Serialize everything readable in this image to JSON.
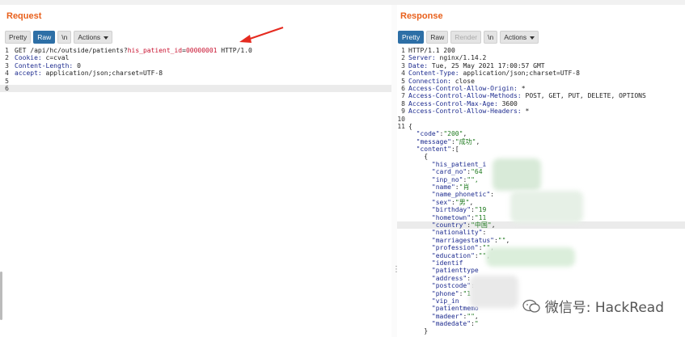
{
  "request": {
    "title": "Request",
    "toolbar": {
      "pretty": "Pretty",
      "raw": "Raw",
      "newline": "\\n",
      "actions": "Actions"
    },
    "lines": [
      {
        "n": "1",
        "parts": [
          {
            "t": "GET /api/hc/outside/patients?",
            "c": "plain"
          },
          {
            "t": "his_patient_id",
            "c": "red"
          },
          {
            "t": "=",
            "c": "plain"
          },
          {
            "t": "00000001",
            "c": "red"
          },
          {
            "t": " HTTP/1.0",
            "c": "plain"
          }
        ]
      },
      {
        "n": "2",
        "parts": [
          {
            "t": "Cookie: ",
            "c": "hk"
          },
          {
            "t": "c=cval",
            "c": "hv"
          }
        ]
      },
      {
        "n": "3",
        "parts": [
          {
            "t": "Content-Length: ",
            "c": "hk"
          },
          {
            "t": "0",
            "c": "hv"
          }
        ]
      },
      {
        "n": "4",
        "parts": [
          {
            "t": "accept: ",
            "c": "hk"
          },
          {
            "t": "application/json;charset=UTF-8",
            "c": "hv"
          }
        ]
      },
      {
        "n": "5",
        "parts": []
      },
      {
        "n": "6",
        "parts": [],
        "highlight": true
      }
    ]
  },
  "response": {
    "title": "Response",
    "toolbar": {
      "pretty": "Pretty",
      "raw": "Raw",
      "render": "Render",
      "newline": "\\n",
      "actions": "Actions"
    },
    "lines": [
      {
        "n": "1",
        "parts": [
          {
            "t": "HTTP/1.1 200",
            "c": "plain"
          }
        ]
      },
      {
        "n": "2",
        "parts": [
          {
            "t": "Server: ",
            "c": "hk"
          },
          {
            "t": "nginx/1.14.2",
            "c": "hv"
          }
        ]
      },
      {
        "n": "3",
        "parts": [
          {
            "t": "Date: ",
            "c": "hk"
          },
          {
            "t": "Tue, 25 May 2021 17:00:57 GMT",
            "c": "hv"
          }
        ]
      },
      {
        "n": "4",
        "parts": [
          {
            "t": "Content-Type: ",
            "c": "hk"
          },
          {
            "t": "application/json;charset=UTF-8",
            "c": "hv"
          }
        ]
      },
      {
        "n": "5",
        "parts": [
          {
            "t": "Connection: ",
            "c": "hk"
          },
          {
            "t": "close",
            "c": "hv"
          }
        ]
      },
      {
        "n": "6",
        "parts": [
          {
            "t": "Access-Control-Allow-Origin: ",
            "c": "hk"
          },
          {
            "t": "*",
            "c": "hv"
          }
        ]
      },
      {
        "n": "7",
        "parts": [
          {
            "t": "Access-Control-Allow-Methods: ",
            "c": "hk"
          },
          {
            "t": "POST, GET, PUT, DELETE, OPTIONS",
            "c": "hv"
          }
        ]
      },
      {
        "n": "8",
        "parts": [
          {
            "t": "Access-Control-Max-Age: ",
            "c": "hk"
          },
          {
            "t": "3600",
            "c": "hv"
          }
        ]
      },
      {
        "n": "9",
        "parts": [
          {
            "t": "Access-Control-Allow-Headers: ",
            "c": "hk"
          },
          {
            "t": "*",
            "c": "hv"
          }
        ]
      },
      {
        "n": "10",
        "parts": []
      },
      {
        "n": "11",
        "parts": [
          {
            "t": "{",
            "c": "plain"
          }
        ]
      },
      {
        "n": "",
        "parts": [
          {
            "t": "  \"code\"",
            "c": "k"
          },
          {
            "t": ":",
            "c": "plain"
          },
          {
            "t": "\"200\"",
            "c": "s"
          },
          {
            "t": ",",
            "c": "plain"
          }
        ]
      },
      {
        "n": "",
        "parts": [
          {
            "t": "  \"message\"",
            "c": "k"
          },
          {
            "t": ":",
            "c": "plain"
          },
          {
            "t": "\"成功\"",
            "c": "s"
          },
          {
            "t": ",",
            "c": "plain"
          }
        ]
      },
      {
        "n": "",
        "parts": [
          {
            "t": "  \"content\"",
            "c": "k"
          },
          {
            "t": ":[",
            "c": "plain"
          }
        ]
      },
      {
        "n": "",
        "parts": [
          {
            "t": "    {",
            "c": "plain"
          }
        ]
      },
      {
        "n": "",
        "parts": [
          {
            "t": "      \"his_patient_i",
            "c": "k"
          }
        ]
      },
      {
        "n": "",
        "parts": [
          {
            "t": "      \"card_no\"",
            "c": "k"
          },
          {
            "t": ":",
            "c": "plain"
          },
          {
            "t": "\"64",
            "c": "s"
          }
        ]
      },
      {
        "n": "",
        "parts": [
          {
            "t": "      \"inp_no\"",
            "c": "k"
          },
          {
            "t": ":",
            "c": "plain"
          },
          {
            "t": "\"\",",
            "c": "s"
          }
        ]
      },
      {
        "n": "",
        "parts": [
          {
            "t": "      \"name\"",
            "c": "k"
          },
          {
            "t": ":",
            "c": "plain"
          },
          {
            "t": "\"肖",
            "c": "s"
          }
        ]
      },
      {
        "n": "",
        "parts": [
          {
            "t": "      \"name_phonetic\"",
            "c": "k"
          },
          {
            "t": ": ",
            "c": "plain"
          }
        ]
      },
      {
        "n": "",
        "parts": [
          {
            "t": "      \"sex\"",
            "c": "k"
          },
          {
            "t": ":",
            "c": "plain"
          },
          {
            "t": "\"男\"",
            "c": "s"
          },
          {
            "t": ",",
            "c": "plain"
          }
        ]
      },
      {
        "n": "",
        "parts": [
          {
            "t": "      \"birthday\"",
            "c": "k"
          },
          {
            "t": ":",
            "c": "plain"
          },
          {
            "t": "\"19",
            "c": "s"
          }
        ]
      },
      {
        "n": "",
        "parts": [
          {
            "t": "      \"hometown\"",
            "c": "k"
          },
          {
            "t": ":",
            "c": "plain"
          },
          {
            "t": "\"11",
            "c": "s"
          }
        ]
      },
      {
        "n": "",
        "parts": [
          {
            "t": "      \"country\"",
            "c": "k"
          },
          {
            "t": ":",
            "c": "plain"
          },
          {
            "t": "\"中国\"",
            "c": "s"
          },
          {
            "t": ",",
            "c": "plain"
          }
        ],
        "highlight": true
      },
      {
        "n": "",
        "parts": [
          {
            "t": "      \"nationality\"",
            "c": "k"
          },
          {
            "t": ":",
            "c": "plain"
          }
        ]
      },
      {
        "n": "",
        "parts": [
          {
            "t": "      \"marriagestatus\"",
            "c": "k"
          },
          {
            "t": ":",
            "c": "plain"
          },
          {
            "t": "\"\"",
            "c": "s"
          },
          {
            "t": ",",
            "c": "plain"
          }
        ]
      },
      {
        "n": "",
        "parts": [
          {
            "t": "      \"profession\"",
            "c": "k"
          },
          {
            "t": ":",
            "c": "plain"
          },
          {
            "t": "\"\"",
            "c": "s"
          },
          {
            "t": ",",
            "c": "plain"
          }
        ]
      },
      {
        "n": "",
        "parts": [
          {
            "t": "      \"education\"",
            "c": "k"
          },
          {
            "t": ":",
            "c": "plain"
          },
          {
            "t": "\"\"",
            "c": "s"
          },
          {
            "t": ",",
            "c": "plain"
          }
        ]
      },
      {
        "n": "",
        "parts": [
          {
            "t": "      \"identif",
            "c": "k"
          }
        ]
      },
      {
        "n": "",
        "parts": [
          {
            "t": "      \"patienttype",
            "c": "k"
          }
        ]
      },
      {
        "n": "",
        "parts": [
          {
            "t": "      \"address\"",
            "c": "k"
          },
          {
            "t": ":",
            "c": "plain"
          }
        ]
      },
      {
        "n": "",
        "parts": [
          {
            "t": "      \"postcode\"",
            "c": "k"
          },
          {
            "t": ":",
            "c": "plain"
          }
        ]
      },
      {
        "n": "",
        "parts": [
          {
            "t": "      \"phone\"",
            "c": "k"
          },
          {
            "t": ":",
            "c": "plain"
          },
          {
            "t": "\"1",
            "c": "s"
          }
        ]
      },
      {
        "n": "",
        "parts": [
          {
            "t": "      \"vip_in",
            "c": "k"
          }
        ]
      },
      {
        "n": "",
        "parts": [
          {
            "t": "      \"patientmemo",
            "c": "k"
          }
        ]
      },
      {
        "n": "",
        "parts": [
          {
            "t": "      \"madeer\"",
            "c": "k"
          },
          {
            "t": ":",
            "c": "plain"
          },
          {
            "t": "\"\"",
            "c": "s"
          },
          {
            "t": ",",
            "c": "plain"
          }
        ]
      },
      {
        "n": "",
        "parts": [
          {
            "t": "      \"madedate\"",
            "c": "k"
          },
          {
            "t": ":",
            "c": "plain"
          },
          {
            "t": "\"",
            "c": "s"
          }
        ]
      },
      {
        "n": "",
        "parts": [
          {
            "t": "    }",
            "c": "plain"
          }
        ]
      }
    ]
  },
  "watermark": {
    "text": "微信号: HackRead",
    "icon": "wechat-icon"
  },
  "annotation": {
    "icon": "red-arrow-icon",
    "color": "#e52b20"
  },
  "colors": {
    "accent": "#e8601c",
    "active_button": "#2d6fa6",
    "header_key": "#1d2b8f",
    "string": "#1f7a1f",
    "param": "#c8102e"
  }
}
